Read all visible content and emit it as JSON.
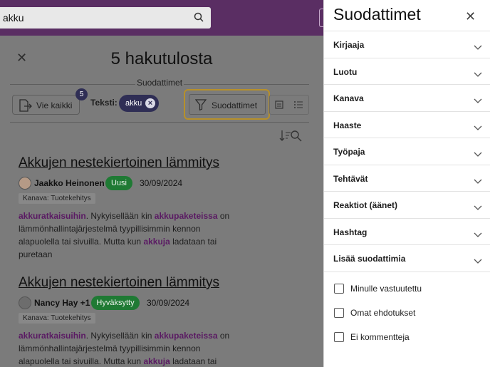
{
  "search": {
    "value": "akku"
  },
  "results": {
    "title": "5 hakutulosta",
    "filters_heading": "Suodattimet",
    "export_label": "Vie kaikki",
    "export_count": "5",
    "text_filter_label": "Teksti:",
    "text_chip": "akku",
    "filters_button": "Suodattimet",
    "items": [
      {
        "title": "Akkujen nestekiertoinen lämmitys",
        "author": "Jaakko Heinonen",
        "status": "Uusi",
        "date": "30/09/2024",
        "channel": "Kanava: Tuotekehitys",
        "body": {
          "hl1": "akkuratkaisuihin",
          "t1": ". Nykyisellään kin ",
          "hl2": "akkupaketeissa",
          "t2": " on lämmönhallintajärjestelmä tyypillisimmin kennon alapuolella tai sivuilla. Mutta kun ",
          "hl3": "akkuja",
          "t3": " ladataan tai puretaan"
        }
      },
      {
        "title": "Akkujen nestekiertoinen lämmitys",
        "author": "Nancy Hay +1",
        "status": "Hyväksytty",
        "date": "30/09/2024",
        "channel": "Kanava: Tuotekehitys",
        "body": {
          "hl1": "akkuratkaisuihin",
          "t1": ". Nykyisellään kin ",
          "hl2": "akkupaketeissa",
          "t2": " on lämmönhallintajärjestelmä tyypillisimmin kennon alapuolella tai sivuilla. Mutta kun ",
          "hl3": "akkuja",
          "t3": " ladataan tai"
        }
      }
    ]
  },
  "panel": {
    "title": "Suodattimet",
    "sections": [
      "Kirjaaja",
      "Luotu",
      "Kanava",
      "Haaste",
      "Työpaja",
      "Tehtävät",
      "Reaktiot (äänet)",
      "Hashtag",
      "Lisää suodattimia"
    ],
    "checkboxes": [
      "Minulle vastuutettu",
      "Omat ehdotukset",
      "Ei kommentteja"
    ]
  },
  "colors": {
    "brand": "#5a2e63",
    "accent_chip": "#2f2e55",
    "status_green": "#1f7a34",
    "highlight": "#b7902a"
  }
}
